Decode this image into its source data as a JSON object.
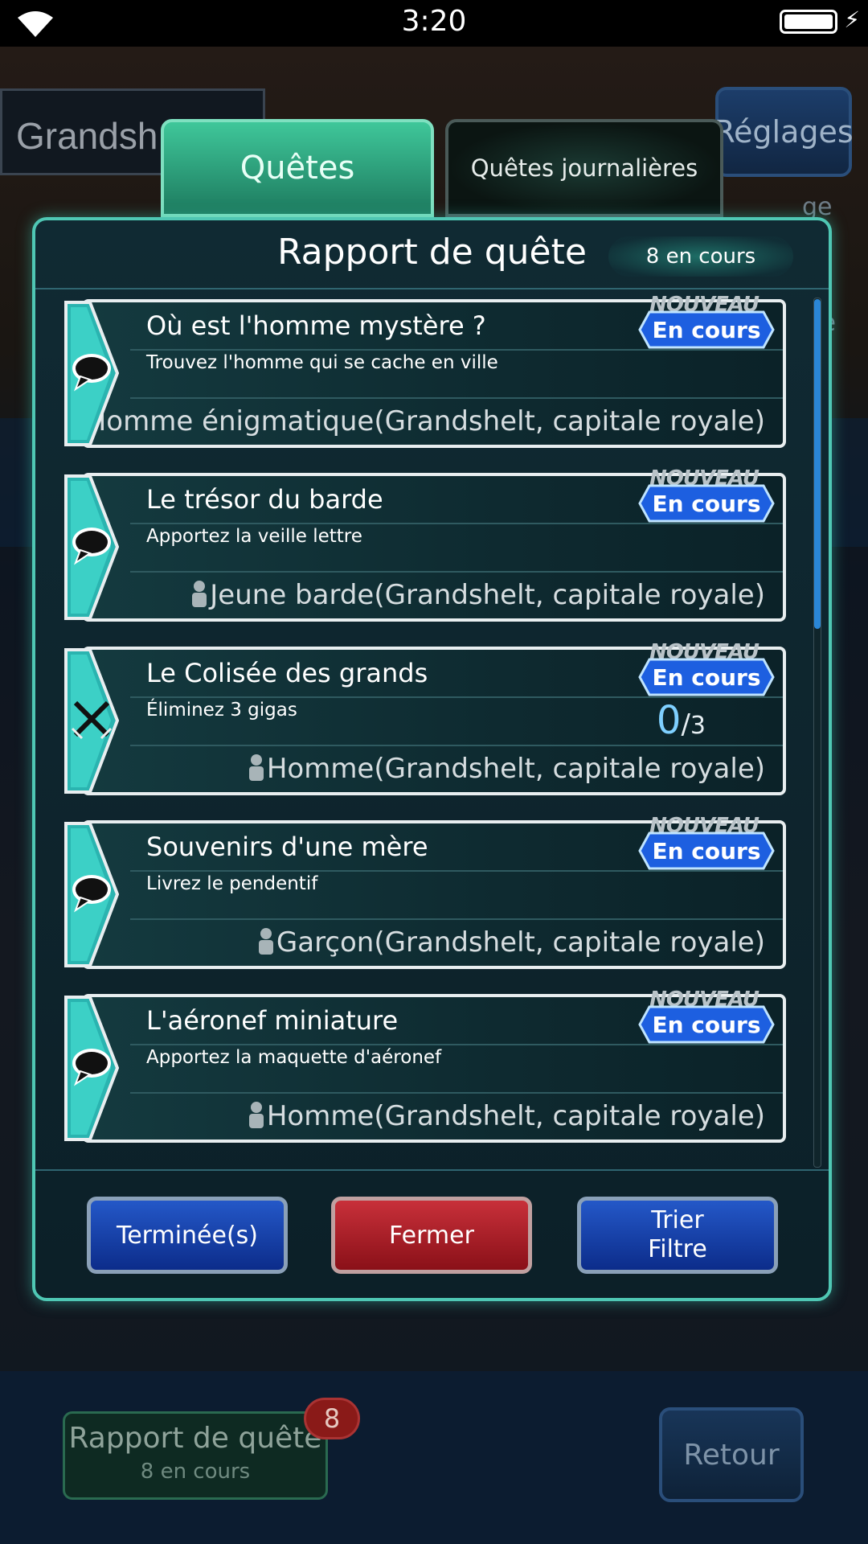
{
  "status_bar": {
    "time": "3:20"
  },
  "background": {
    "location_title": "Grandsh",
    "settings_button": "Réglages",
    "side_text": "ge du\n\ne\ntre\nnt",
    "report_button_title": "Rapport de quête",
    "report_button_sub": "8 en cours",
    "report_badge": "8",
    "back_button": "Retour"
  },
  "tabs": [
    {
      "label": "Quêtes",
      "active": true
    },
    {
      "label": "Quêtes journalières",
      "active": false
    }
  ],
  "panel": {
    "title": "Rapport de quête",
    "count": "8 en cours"
  },
  "quests": [
    {
      "icon": "speech-bubble-icon",
      "title": "Où est l'homme mystère ?",
      "desc": "Trouvez l'homme qui se cache en ville",
      "npc": "Homme énigmatique(Grandshelt, capitale royale)",
      "new_label": "NOUVEAU",
      "status": "En cours"
    },
    {
      "icon": "speech-bubble-icon",
      "title": "Le trésor du barde",
      "desc": "Apportez la veille lettre",
      "npc": "Jeune barde(Grandshelt, capitale royale)",
      "new_label": "NOUVEAU",
      "status": "En cours"
    },
    {
      "icon": "crossed-swords-icon",
      "title": "Le Colisée des grands",
      "desc": "Éliminez 3 gigas",
      "npc": "Homme(Grandshelt, capitale royale)",
      "new_label": "NOUVEAU",
      "status": "En cours",
      "progress": {
        "current": "0",
        "sep": "/",
        "total": "3"
      }
    },
    {
      "icon": "speech-bubble-icon",
      "title": "Souvenirs d'une mère",
      "desc": "Livrez le pendentif",
      "npc": "Garçon(Grandshelt, capitale royale)",
      "new_label": "NOUVEAU",
      "status": "En cours"
    },
    {
      "icon": "speech-bubble-icon",
      "title": "L'aéronef miniature",
      "desc": "Apportez la maquette d'aéronef",
      "npc": "Homme(Grandshelt, capitale royale)",
      "new_label": "NOUVEAU",
      "status": "En cours"
    }
  ],
  "buttons": {
    "done": "Terminée(s)",
    "close": "Fermer",
    "sort_line1": "Trier",
    "sort_line2": "Filtre"
  },
  "colors": {
    "accent_teal": "#4fc7b4",
    "status_blue": "#1d5fe0",
    "close_red": "#c8303a"
  }
}
